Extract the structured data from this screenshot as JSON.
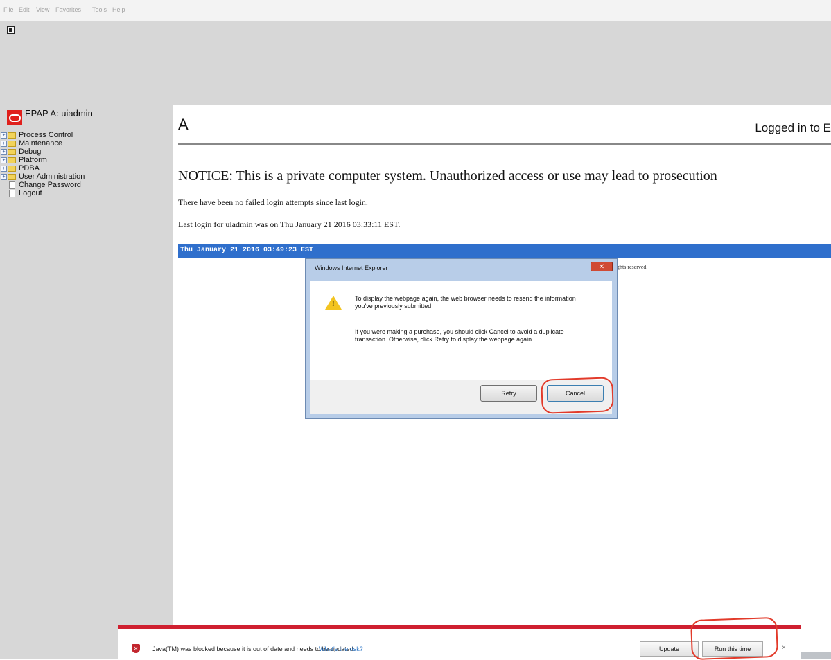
{
  "menubar": {
    "file": "File",
    "edit": "Edit",
    "view": "View",
    "favorites": "Favorites",
    "tools": "Tools",
    "help": "Help"
  },
  "nav": {
    "title": "EPAP A: uiadmin",
    "items": [
      {
        "label": "Process Control",
        "kind": "folder"
      },
      {
        "label": "Maintenance",
        "kind": "folder"
      },
      {
        "label": "Debug",
        "kind": "folder"
      },
      {
        "label": "Platform",
        "kind": "folder"
      },
      {
        "label": "PDBA",
        "kind": "folder"
      },
      {
        "label": "User Administration",
        "kind": "folder"
      },
      {
        "label": "Change Password",
        "kind": "page"
      },
      {
        "label": "Logout",
        "kind": "page"
      }
    ]
  },
  "content": {
    "brand_letter": "A",
    "logged_in": "Logged in to E",
    "notice": "NOTICE: This is a private computer system. Unauthorized access or use may lead to prosecution",
    "failed_logins": "There have been no failed login attempts since last login.",
    "last_login": "Last login for uiadmin was on Thu January 21 2016 03:33:11 EST.",
    "datebar": "Thu January 21 2016 03:49:23 EST",
    "rights_fragment": "ghts reserved."
  },
  "dialog": {
    "title": "Windows Internet Explorer",
    "close_label": "✕",
    "p1": "To display the webpage again, the web browser needs to resend the information you've previously submitted.",
    "p2": "If you were making a purchase, you should click Cancel to avoid a duplicate transaction. Otherwise, click Retry to display the webpage again.",
    "retry_label": "Retry",
    "cancel_label": "Cancel"
  },
  "java_bar": {
    "message": "Java(TM) was blocked because it is out of date and needs to be updated.",
    "risk_link": "What's the risk?",
    "update_label": "Update",
    "run_label": "Run this time",
    "close_label": "×"
  },
  "colors": {
    "chrome_gray": "#d7d7d7",
    "date_bar_blue": "#2f6fcc",
    "annotation_red": "#e23a2a",
    "java_bar_red": "#cf2030",
    "oracle_red": "#e0201c"
  }
}
